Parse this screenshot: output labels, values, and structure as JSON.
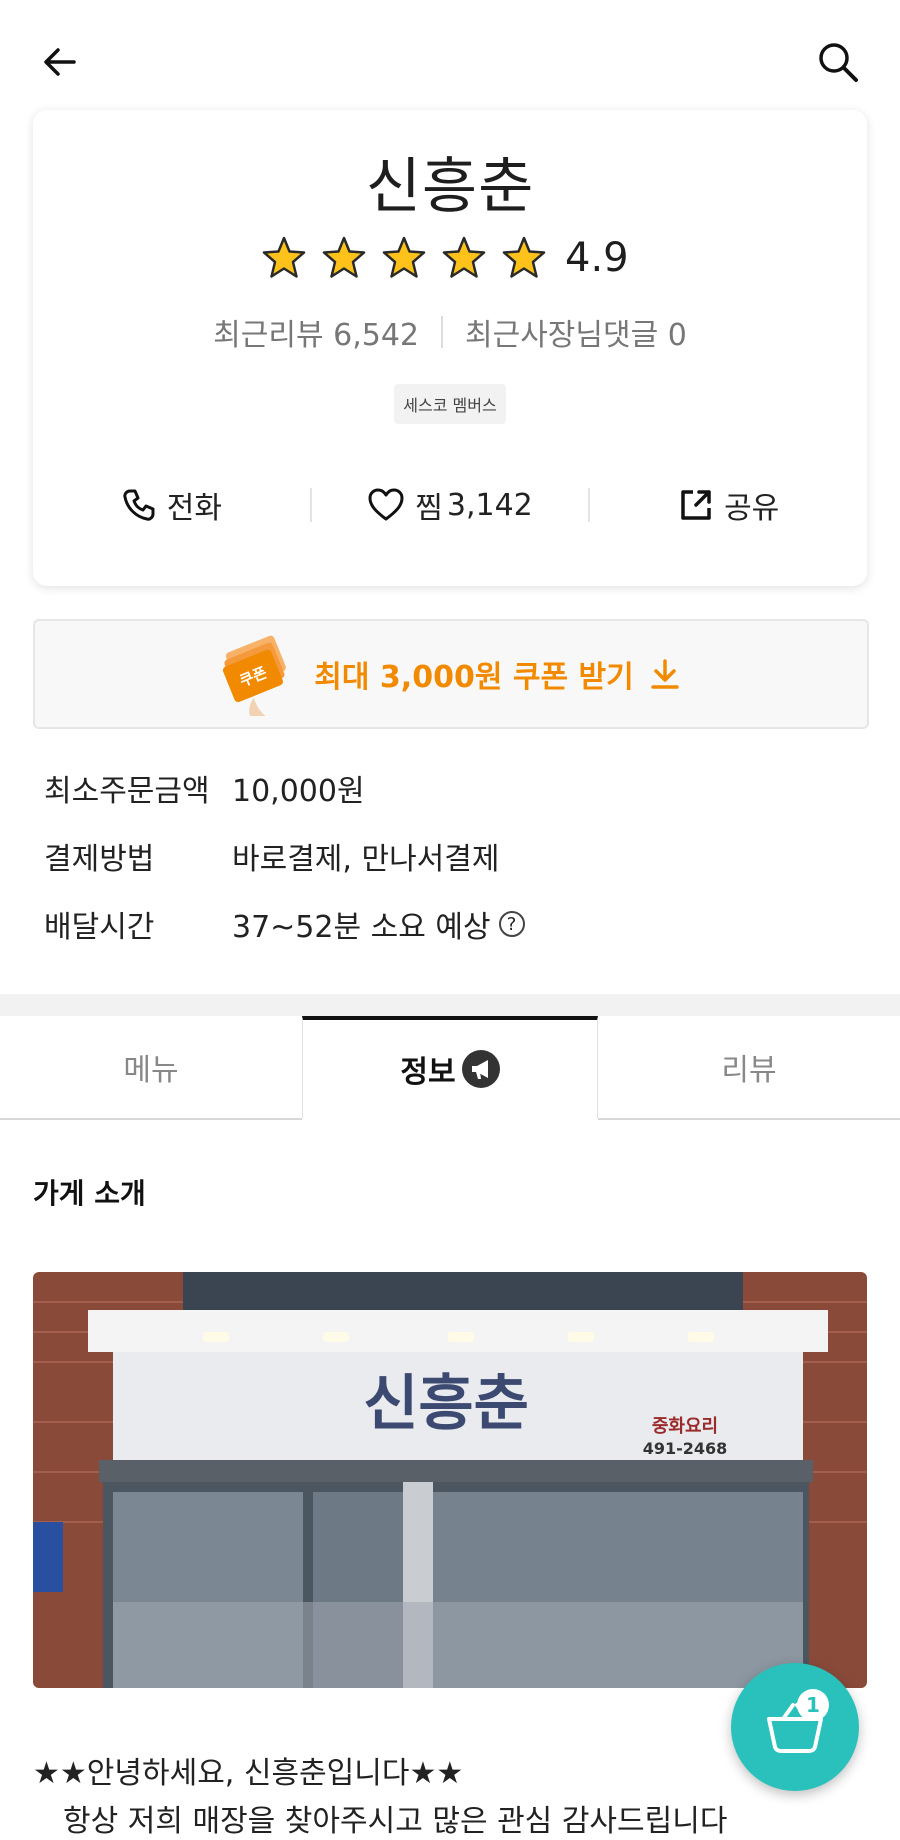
{
  "header": {
    "back_icon": "back-arrow-icon",
    "search_icon": "search-icon"
  },
  "store": {
    "name": "신흥춘",
    "rating": "4.9",
    "rating_stars": 5,
    "recent_reviews": "최근리뷰 6,542",
    "recent_owner_replies": "최근사장님댓글 0",
    "badge": "세스코 멤버스"
  },
  "actions": {
    "call_label": "전화",
    "like_label": "찜",
    "like_count": "3,142",
    "share_label": "공유"
  },
  "coupon": {
    "icon_label": "쿠폰",
    "text": "최대 3,000원 쿠폰 받기",
    "accent_color": "#f28a00"
  },
  "info": [
    {
      "label": "최소주문금액",
      "value": "10,000원"
    },
    {
      "label": "결제방법",
      "value": "바로결제, 만나서결제"
    },
    {
      "label": "배달시간",
      "value": "37~52분 소요 예상"
    }
  ],
  "tabs": [
    {
      "label": "메뉴",
      "active": false
    },
    {
      "label": "정보",
      "active": true
    },
    {
      "label": "리뷰",
      "active": false
    }
  ],
  "section": {
    "title": "가게 소개"
  },
  "photo": {
    "sign_name": "신흥춘",
    "sign_sub": "중화요리",
    "sign_phone": "491-2468"
  },
  "intro": {
    "line1": "★★안녕하세요, 신흥춘입니다★★",
    "line2": "항상 저희 매장을 찾아주시고 많은 관심 감사드립니다"
  },
  "cart": {
    "count": "1",
    "brand_color": "#2ac1bc"
  }
}
